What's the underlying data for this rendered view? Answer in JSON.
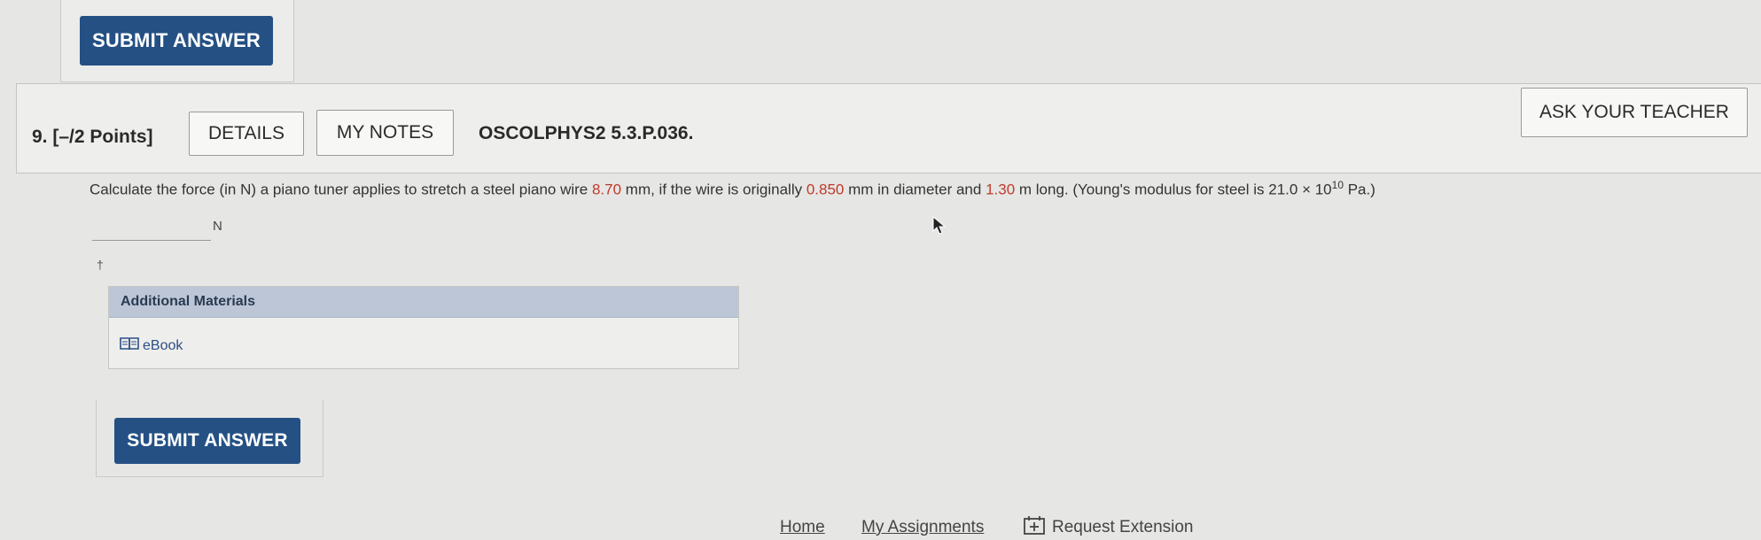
{
  "top": {
    "submit_label": "SUBMIT ANSWER"
  },
  "question": {
    "number_points": "9.  [–/2 Points]",
    "details_label": "DETAILS",
    "notes_label": "MY NOTES",
    "code": "OSCOLPHYS2 5.3.P.036.",
    "ask_label": "ASK YOUR TEACHER",
    "text": {
      "part1": "Calculate the force (in N) a piano tuner applies to stretch a steel piano wire ",
      "stretch": "8.70",
      "part2": " mm, if the wire is originally ",
      "diameter": "0.850",
      "part3": " mm in diameter and ",
      "length": "1.30",
      "part4": " m long. (Young's modulus for steel is 21.0 × 10",
      "exponent": "10",
      "part5": " Pa.)"
    },
    "answer_value": "",
    "unit": "N",
    "dagger": "†"
  },
  "materials": {
    "heading": "Additional Materials",
    "ebook_label": "eBook"
  },
  "bottom": {
    "submit_label": "SUBMIT ANSWER"
  },
  "footer": {
    "home": "Home",
    "assignments": "My Assignments",
    "extension": "Request Extension"
  },
  "colors": {
    "submit_bg": "#245084",
    "highlight_red": "#c0392b",
    "materials_header": "#bcc6d6"
  }
}
